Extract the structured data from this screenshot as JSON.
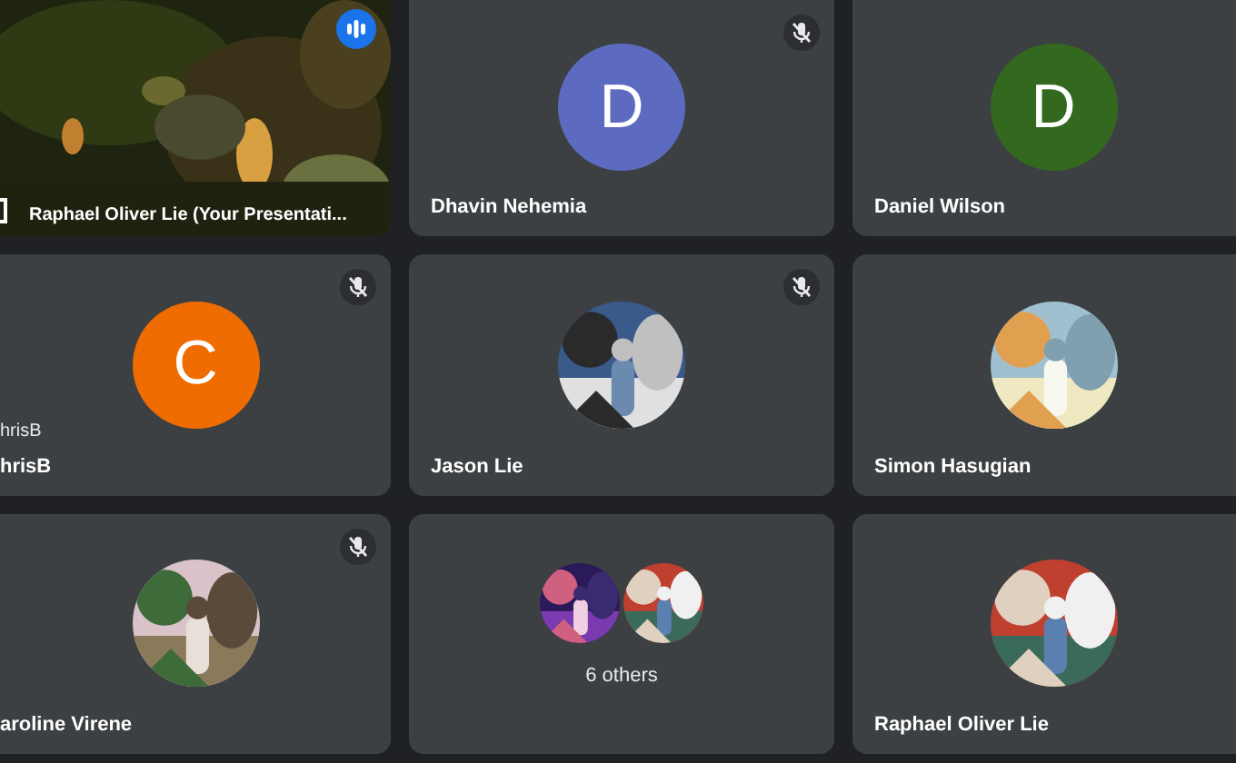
{
  "tiles": [
    {
      "kind": "video",
      "name": "Raphael Oliver Lie (Your Presentati...",
      "speaking": true,
      "presenting": true
    },
    {
      "kind": "letter",
      "name": "Dhavin Nehemia",
      "letter": "D",
      "color": "#5c6bc0",
      "muted": true
    },
    {
      "kind": "letter",
      "name": "Daniel Wilson",
      "letter": "D",
      "color": "#33691e",
      "muted": false
    },
    {
      "kind": "letter",
      "name": "hrisB",
      "caption": "hrisB",
      "letter": "C",
      "color": "#ef6c00",
      "muted": true
    },
    {
      "name": "Jason Lie",
      "muted": true
    },
    {
      "name": "Simon Hasugian",
      "muted": false
    },
    {
      "name": "aroline Virene",
      "muted": true
    },
    {
      "kind": "others",
      "label": "6 others",
      "muted": false
    },
    {
      "name": "Raphael Oliver Lie",
      "muted": false
    }
  ]
}
